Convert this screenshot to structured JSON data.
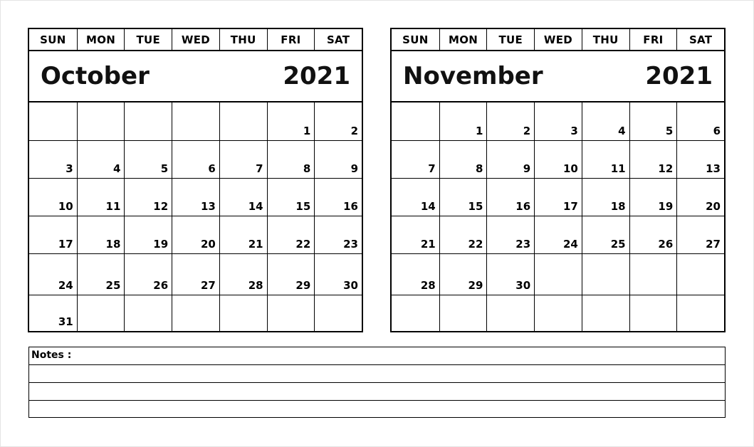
{
  "weekdays": [
    "SUN",
    "MON",
    "TUE",
    "WED",
    "THU",
    "FRI",
    "SAT"
  ],
  "calendars": [
    {
      "month": "October",
      "year": "2021",
      "weeks": [
        [
          "",
          "",
          "",
          "",
          "",
          "1",
          "2"
        ],
        [
          "3",
          "4",
          "5",
          "6",
          "7",
          "8",
          "9"
        ],
        [
          "10",
          "11",
          "12",
          "13",
          "14",
          "15",
          "16"
        ],
        [
          "17",
          "18",
          "19",
          "20",
          "21",
          "22",
          "23"
        ],
        [
          "24",
          "25",
          "26",
          "27",
          "28",
          "29",
          "30"
        ],
        [
          "31",
          "",
          "",
          "",
          "",
          "",
          ""
        ]
      ]
    },
    {
      "month": "November",
      "year": "2021",
      "weeks": [
        [
          "",
          "1",
          "2",
          "3",
          "4",
          "5",
          "6"
        ],
        [
          "7",
          "8",
          "9",
          "10",
          "11",
          "12",
          "13"
        ],
        [
          "14",
          "15",
          "16",
          "17",
          "18",
          "19",
          "20"
        ],
        [
          "21",
          "22",
          "23",
          "24",
          "25",
          "26",
          "27"
        ],
        [
          "28",
          "29",
          "30",
          "",
          "",
          "",
          ""
        ],
        [
          "",
          "",
          "",
          "",
          "",
          "",
          ""
        ]
      ]
    }
  ],
  "notes": {
    "label": "Notes :",
    "line_count": 4
  }
}
